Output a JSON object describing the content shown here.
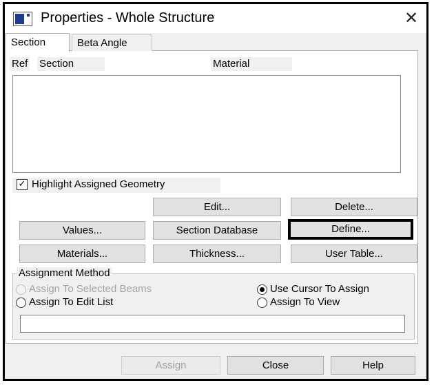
{
  "window": {
    "title": "Properties - Whole Structure",
    "close_glyph": "✕"
  },
  "tabs": [
    {
      "label": "Section",
      "active": true
    },
    {
      "label": "Beta Angle",
      "active": false
    }
  ],
  "list": {
    "headers": {
      "ref": "Ref",
      "section": "Section",
      "material": "Material"
    },
    "rows": []
  },
  "highlight": {
    "label": "Highlight Assigned Geometry",
    "checked": true,
    "check_glyph": "✓"
  },
  "buttons": {
    "edit": "Edit...",
    "delete": "Delete...",
    "values": "Values...",
    "section_database": "Section Database",
    "define": "Define...",
    "materials": "Materials...",
    "thickness": "Thickness...",
    "user_table": "User Table..."
  },
  "assignment": {
    "legend": "Assignment Method",
    "options": [
      {
        "label": "Assign To Selected Beams",
        "selected": false,
        "enabled": false
      },
      {
        "label": "Assign To Edit List",
        "selected": false,
        "enabled": true
      },
      {
        "label": "Use Cursor To Assign",
        "selected": true,
        "enabled": true
      },
      {
        "label": "Assign To View",
        "selected": false,
        "enabled": true
      }
    ],
    "input_value": ""
  },
  "footer": {
    "assign": "Assign",
    "close": "Close",
    "help": "Help"
  },
  "colors": {
    "window_bg": "#f0f0f0",
    "button_bg": "#e1e1e1",
    "title_icon": "#1a3d8f",
    "highlight_border": "#000000"
  }
}
